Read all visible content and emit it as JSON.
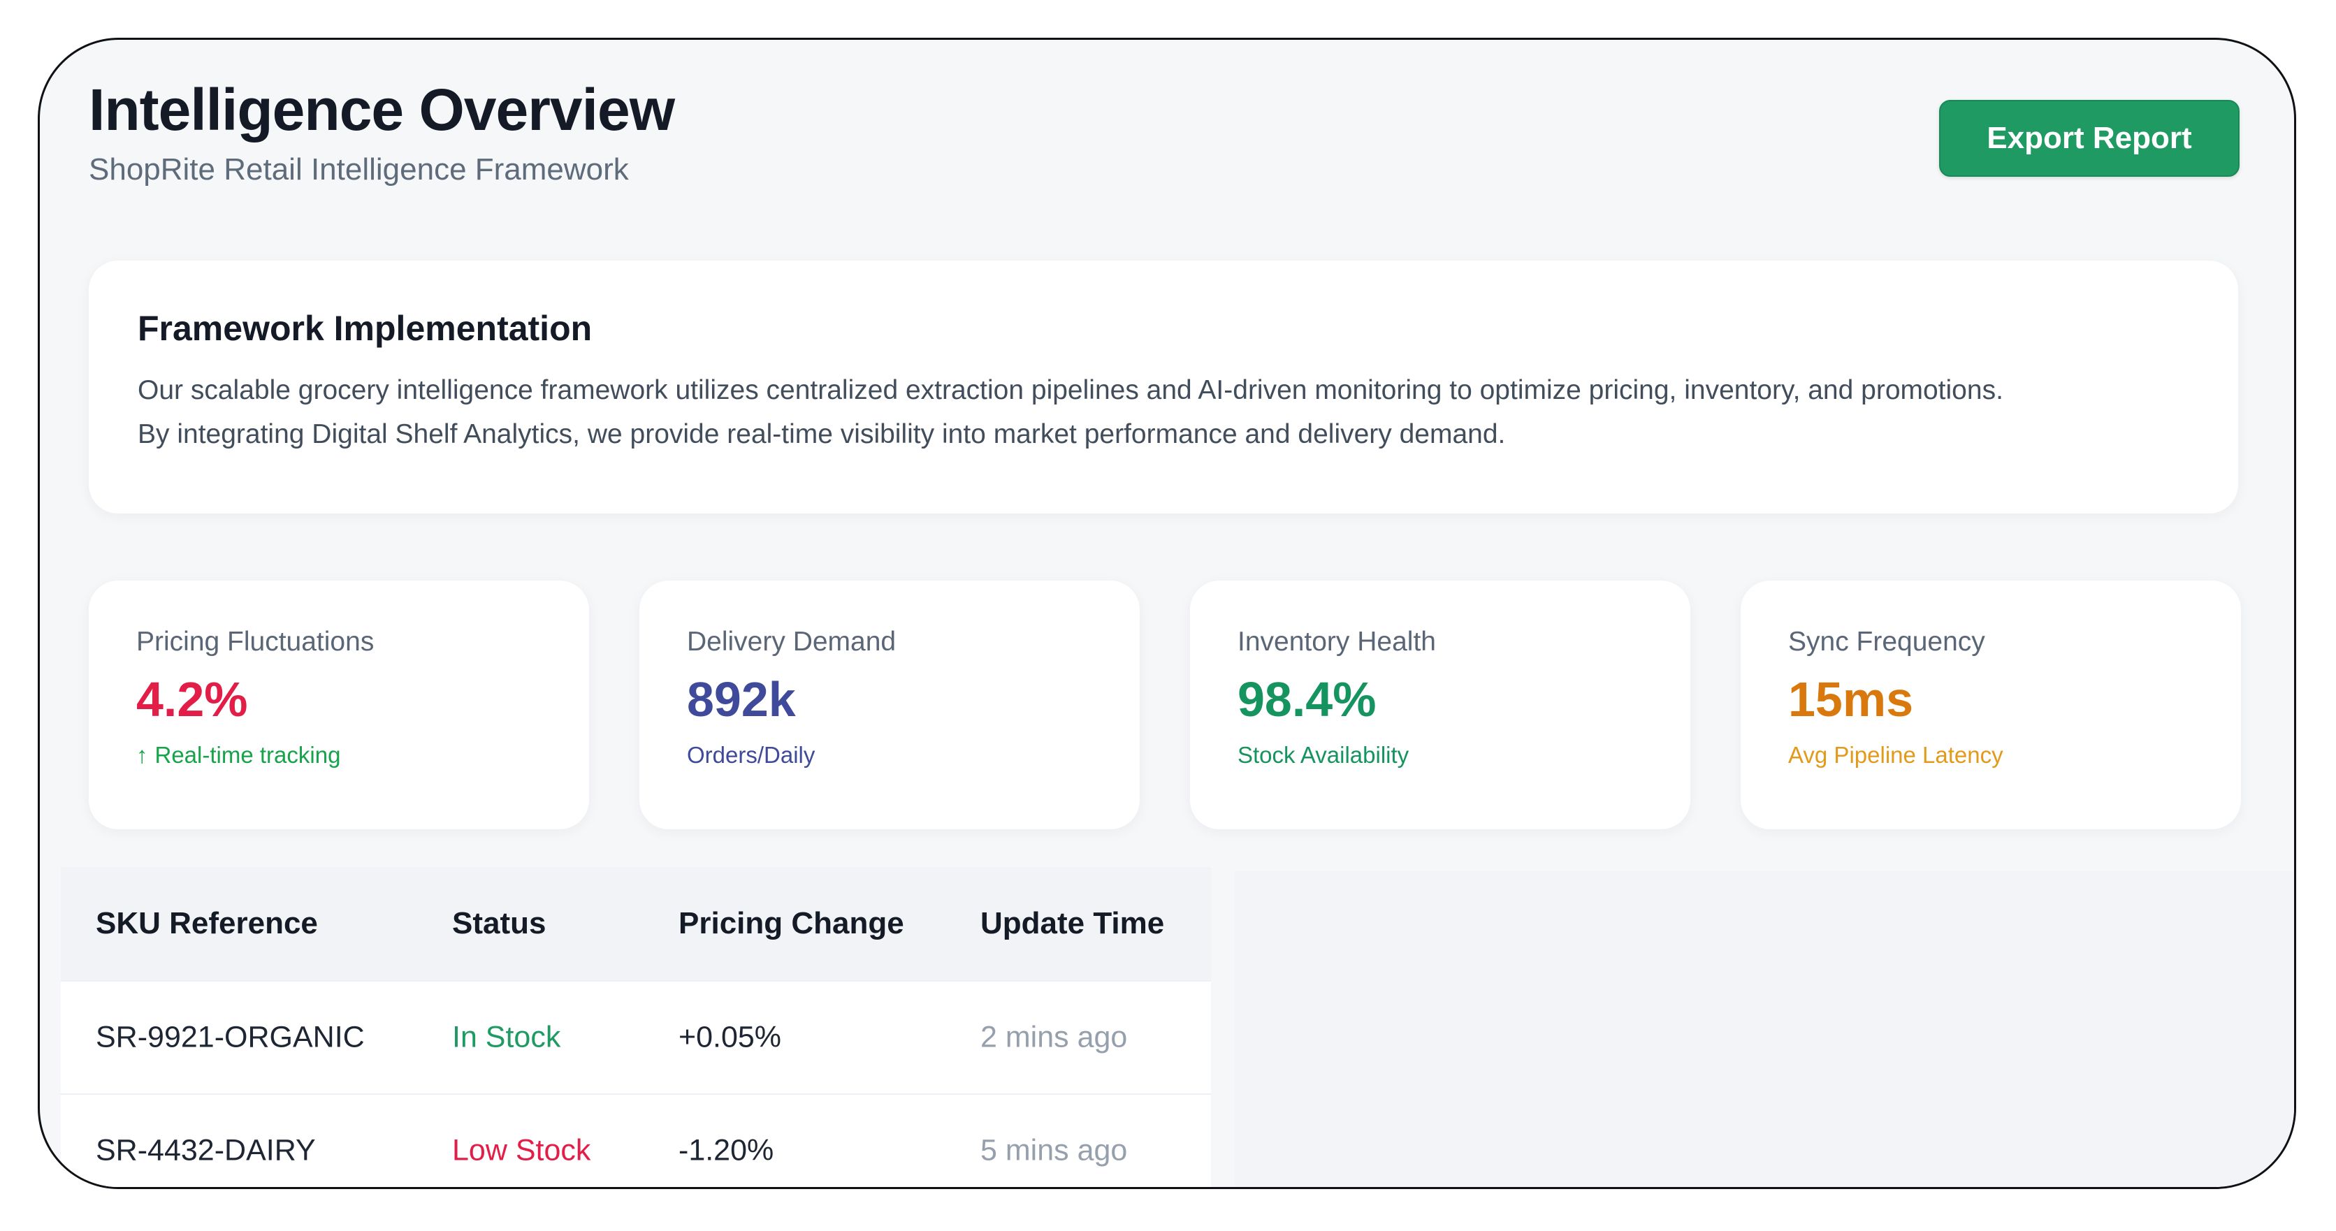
{
  "header": {
    "title": "Intelligence Overview",
    "subtitle": "ShopRite Retail Intelligence Framework",
    "export_label": "Export Report"
  },
  "framework": {
    "title": "Framework Implementation",
    "text_line1": "Our scalable grocery intelligence framework utilizes centralized extraction pipelines and AI-driven monitoring to optimize pricing, inventory, and promotions.",
    "text_line2": "By integrating Digital Shelf Analytics, we provide real-time visibility into market performance and delivery demand."
  },
  "stats": [
    {
      "label": "Pricing Fluctuations",
      "value": "4.2%",
      "note": "Real-time tracking",
      "note_icon": "arrow-up-icon",
      "value_color": "#e11d48",
      "note_color": "#16a34a"
    },
    {
      "label": "Delivery Demand",
      "value": "892k",
      "note": "Orders/Daily",
      "value_color": "#3f4a9b",
      "note_color": "#3f4a9b"
    },
    {
      "label": "Inventory Health",
      "value": "98.4%",
      "note": "Stock Availability",
      "value_color": "#16945f",
      "note_color": "#16945f"
    },
    {
      "label": "Sync Frequency",
      "value": "15ms",
      "note": "Avg Pipeline Latency",
      "value_color": "#d9780d",
      "note_color": "#e39a1b"
    }
  ],
  "table": {
    "headers": [
      "SKU Reference",
      "Status",
      "Pricing Change",
      "Update Time"
    ],
    "rows": [
      {
        "sku": "SR-9921-ORGANIC",
        "status": "In Stock",
        "pricing_change": "+0.05%",
        "update_time": "2 mins ago",
        "status_color": "#1f9a63"
      },
      {
        "sku": "SR-4432-DAIRY",
        "status": "Low Stock",
        "pricing_change": "-1.20%",
        "update_time": "5 mins ago",
        "status_color": "#e11d48"
      }
    ]
  },
  "colors": {
    "accent": "#1f9a63",
    "background": "#f6f7f9",
    "border": "#0f1115"
  }
}
